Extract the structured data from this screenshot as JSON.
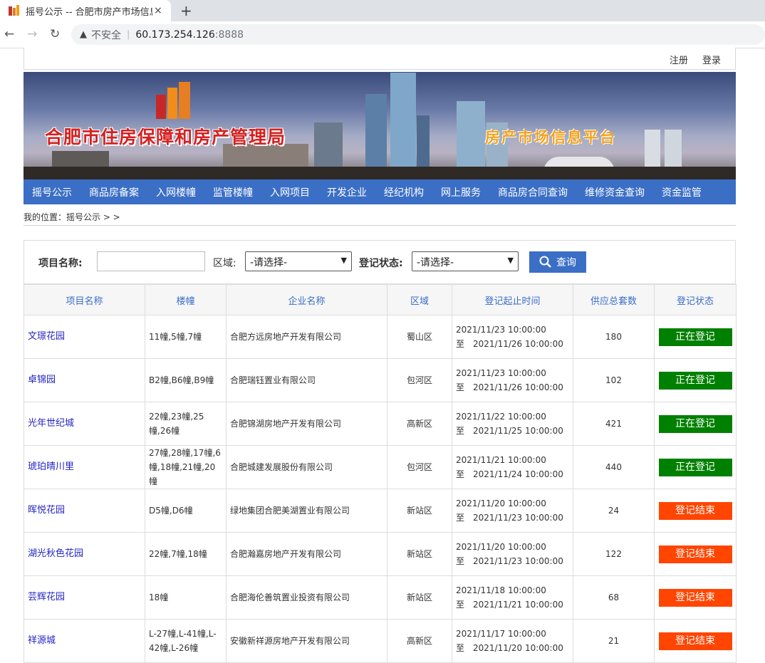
{
  "browser": {
    "tab_title": "摇号公示 -- 合肥市房产市场信息",
    "tab_close": "×",
    "new_tab": "+",
    "insecure_label": "不安全",
    "url_host": "60.173.254.126",
    "url_port": ":8888"
  },
  "topbar": {
    "register": "注册",
    "login": "登录"
  },
  "banner": {
    "title": "合肥市住房保障和房产管理局",
    "subtitle": "房产市场信息平台"
  },
  "nav": [
    "摇号公示",
    "商品房备案",
    "入网楼幢",
    "监管楼幢",
    "入网项目",
    "开发企业",
    "经纪机构",
    "网上服务",
    "商品房合同查询",
    "维修资金查询",
    "资金监管"
  ],
  "breadcrumb": "我的位置：摇号公示 > >",
  "filter": {
    "project_label": "项目名称:",
    "project_value": "",
    "district_label": "区域:",
    "district_value": "-请选择-",
    "status_label": "登记状态:",
    "status_value": "-请选择-",
    "query_button": "查询"
  },
  "table": {
    "headers": [
      "项目名称",
      "楼幢",
      "企业名称",
      "区域",
      "登记起止时间",
      "供应总套数",
      "登记状态"
    ],
    "rows": [
      {
        "name": "文璟花园",
        "buildings": "11幢,5幢,7幢",
        "company": "合肥方远房地产开发有限公司",
        "district": "蜀山区",
        "start": "2021/11/23 10:00:00",
        "end": "至　2021/11/26 10:00:00",
        "total": "180",
        "status": "正在登记",
        "status_color": "#008000"
      },
      {
        "name": "卓锦园",
        "buildings": "B2幢,B6幢,B9幢",
        "company": "合肥瑞钰置业有限公司",
        "district": "包河区",
        "start": "2021/11/23 10:00:00",
        "end": "至　2021/11/26 10:00:00",
        "total": "102",
        "status": "正在登记",
        "status_color": "#008000"
      },
      {
        "name": "光年世纪城",
        "buildings": "22幢,23幢,25幢,26幢",
        "company": "合肥锦湖房地产开发有限公司",
        "district": "高新区",
        "start": "2021/11/22 10:00:00",
        "end": "至　2021/11/25 10:00:00",
        "total": "421",
        "status": "正在登记",
        "status_color": "#008000"
      },
      {
        "name": "琥珀晴川里",
        "buildings": "27幢,28幢,17幢,6幢,18幢,21幢,20幢",
        "company": "合肥城建发展股份有限公司",
        "district": "包河区",
        "start": "2021/11/21 10:00:00",
        "end": "至　2021/11/24 10:00:00",
        "total": "440",
        "status": "正在登记",
        "status_color": "#008000"
      },
      {
        "name": "晖悦花园",
        "buildings": "D5幢,D6幢",
        "company": "绿地集团合肥美湖置业有限公司",
        "district": "新站区",
        "start": "2021/11/20 10:00:00",
        "end": "至　2021/11/23 10:00:00",
        "total": "24",
        "status": "登记结束",
        "status_color": "#ff4500"
      },
      {
        "name": "湖光秋色花园",
        "buildings": "22幢,7幢,18幢",
        "company": "合肥瀚嘉房地产开发有限公司",
        "district": "新站区",
        "start": "2021/11/20 10:00:00",
        "end": "至　2021/11/23 10:00:00",
        "total": "122",
        "status": "登记结束",
        "status_color": "#ff4500"
      },
      {
        "name": "芸辉花园",
        "buildings": "18幢",
        "company": "合肥海伦善筑置业投资有限公司",
        "district": "新站区",
        "start": "2021/11/18 10:00:00",
        "end": "至　2021/11/21 10:00:00",
        "total": "68",
        "status": "登记结束",
        "status_color": "#ff4500"
      },
      {
        "name": "祥源城",
        "buildings": "L-27幢,L-41幢,L-42幢,L-26幢",
        "company": "安徽新祥源房地产开发有限公司",
        "district": "高新区",
        "start": "2021/11/17 10:00:00",
        "end": "至　2021/11/20 10:00:00",
        "total": "21",
        "status": "登记结束",
        "status_color": "#ff4500"
      }
    ]
  }
}
